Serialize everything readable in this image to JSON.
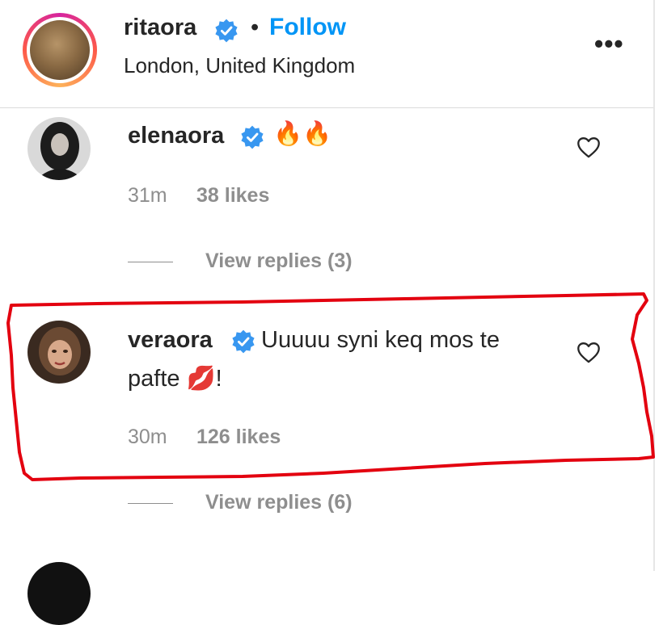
{
  "post_header": {
    "username": "ritaora",
    "separator": "•",
    "follow_label": "Follow",
    "location": "London, United Kingdom",
    "more_label": "•••"
  },
  "comments": [
    {
      "username": "elenaora",
      "text": "🔥🔥",
      "time": "31m",
      "likes": "38 likes",
      "view_replies": "View replies (3)"
    },
    {
      "username": "veraora",
      "text_line1": "Uuuuu syni keq mos te",
      "text_line2_prefix": "pafte ",
      "text_line2_emoji": "💋",
      "text_line2_suffix": "!",
      "time": "30m",
      "likes": "126 likes",
      "view_replies": "View replies (6)"
    }
  ],
  "colors": {
    "accent": "#0095f6",
    "verified": "#3897f0",
    "secondary_text": "#8e8e8e",
    "highlight_stroke": "#e3000f"
  }
}
